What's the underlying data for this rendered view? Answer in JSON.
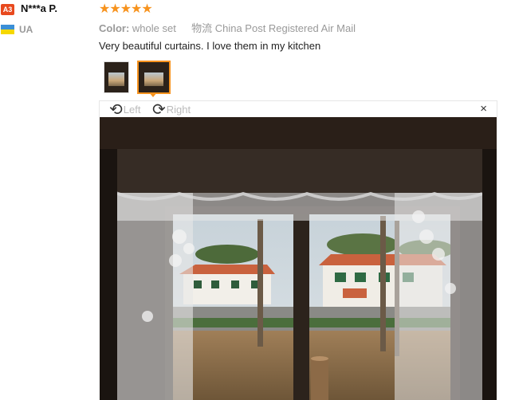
{
  "reviewer": {
    "level_badge": "A3",
    "name": "N***a P.",
    "country": "UA"
  },
  "review": {
    "stars": "★★★★★",
    "color_label": "Color:",
    "color_value": "whole set",
    "shipping_label": "物流",
    "shipping_value": "China Post Registered Air Mail",
    "text": "Very beautiful curtains. I love them in my kitchen"
  },
  "thumbnails": [
    {
      "name": "photo-thumbnail-1",
      "selected": false
    },
    {
      "name": "photo-thumbnail-2",
      "selected": true
    }
  ],
  "viewer": {
    "rotate_left_label": "Left",
    "rotate_right_label": "Right",
    "rotate_left_icon": "rotate-left-icon",
    "rotate_right_icon": "rotate-right-icon",
    "close_icon": "close-icon",
    "close_glyph": "×"
  },
  "colors": {
    "star": "#f7931e",
    "badge": "#e8491e",
    "selected_border": "#f7931e"
  }
}
